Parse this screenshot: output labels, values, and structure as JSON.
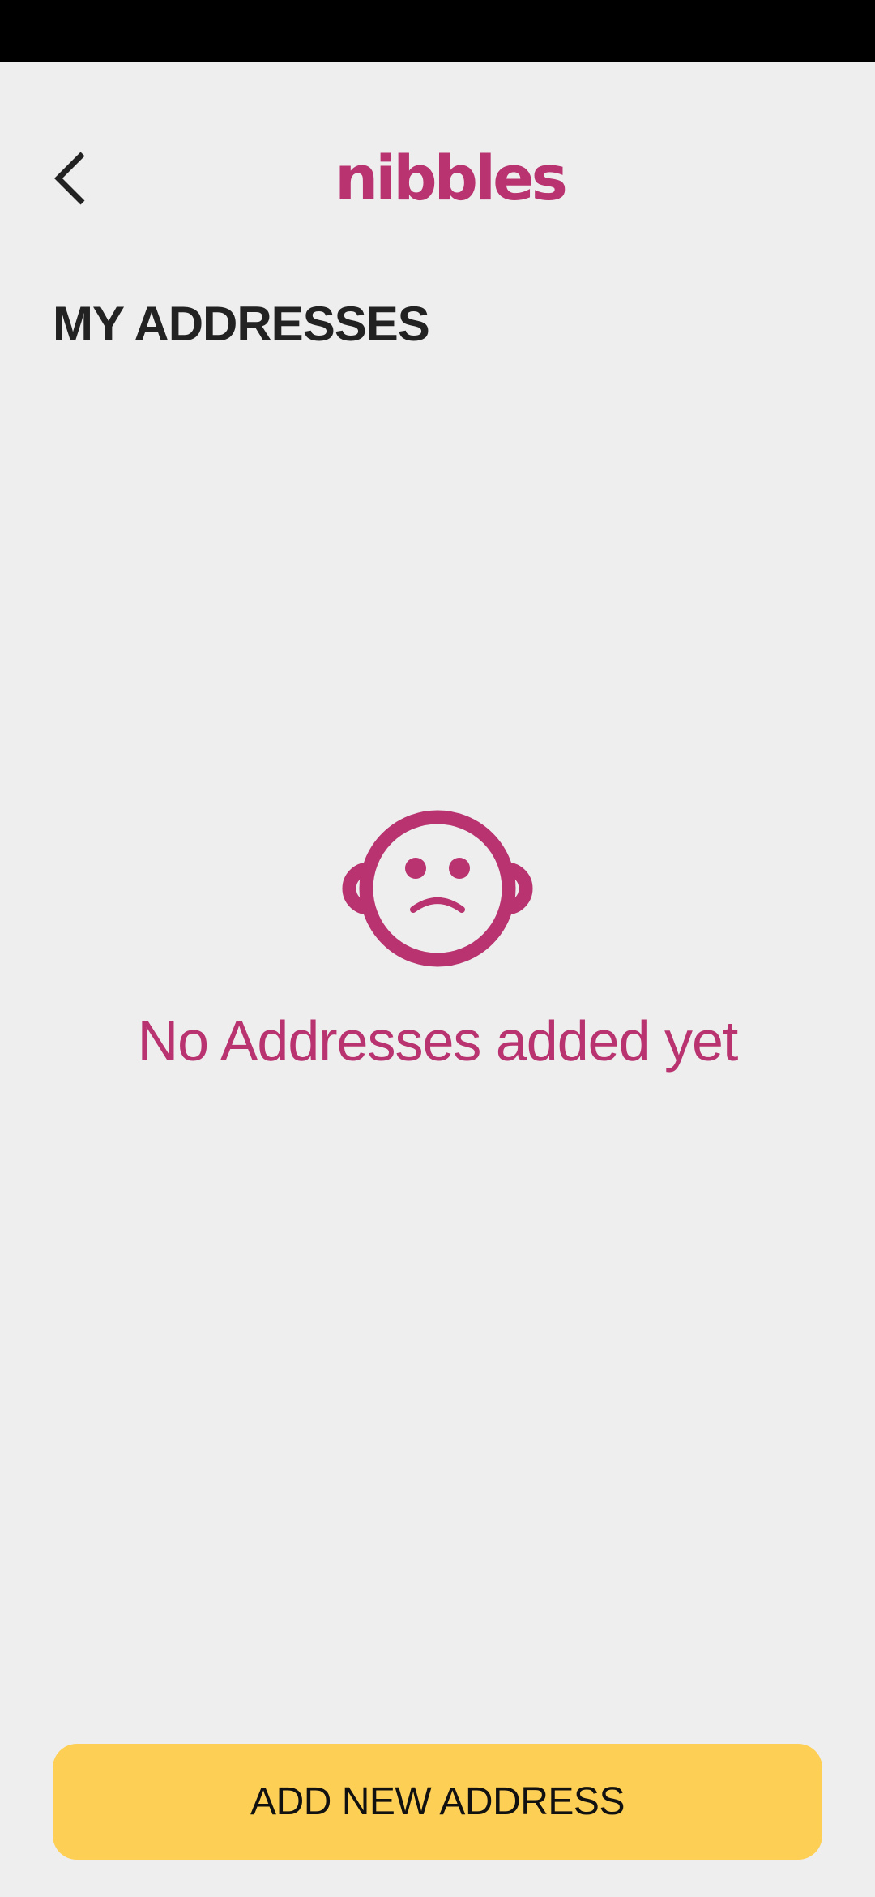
{
  "header": {
    "back_icon": "chevron-left-icon",
    "logo_text": "nibbles"
  },
  "main": {
    "title": "MY ADDRESSES",
    "empty_state": {
      "icon": "sad-baby-face-icon",
      "message": "No Addresses added yet"
    }
  },
  "footer": {
    "add_button_label": "ADD NEW ADDRESS"
  },
  "colors": {
    "brand": "#b8336f",
    "accent": "#fecf55",
    "background": "#eeeeee",
    "text": "#222222",
    "status_bar": "#000000"
  }
}
